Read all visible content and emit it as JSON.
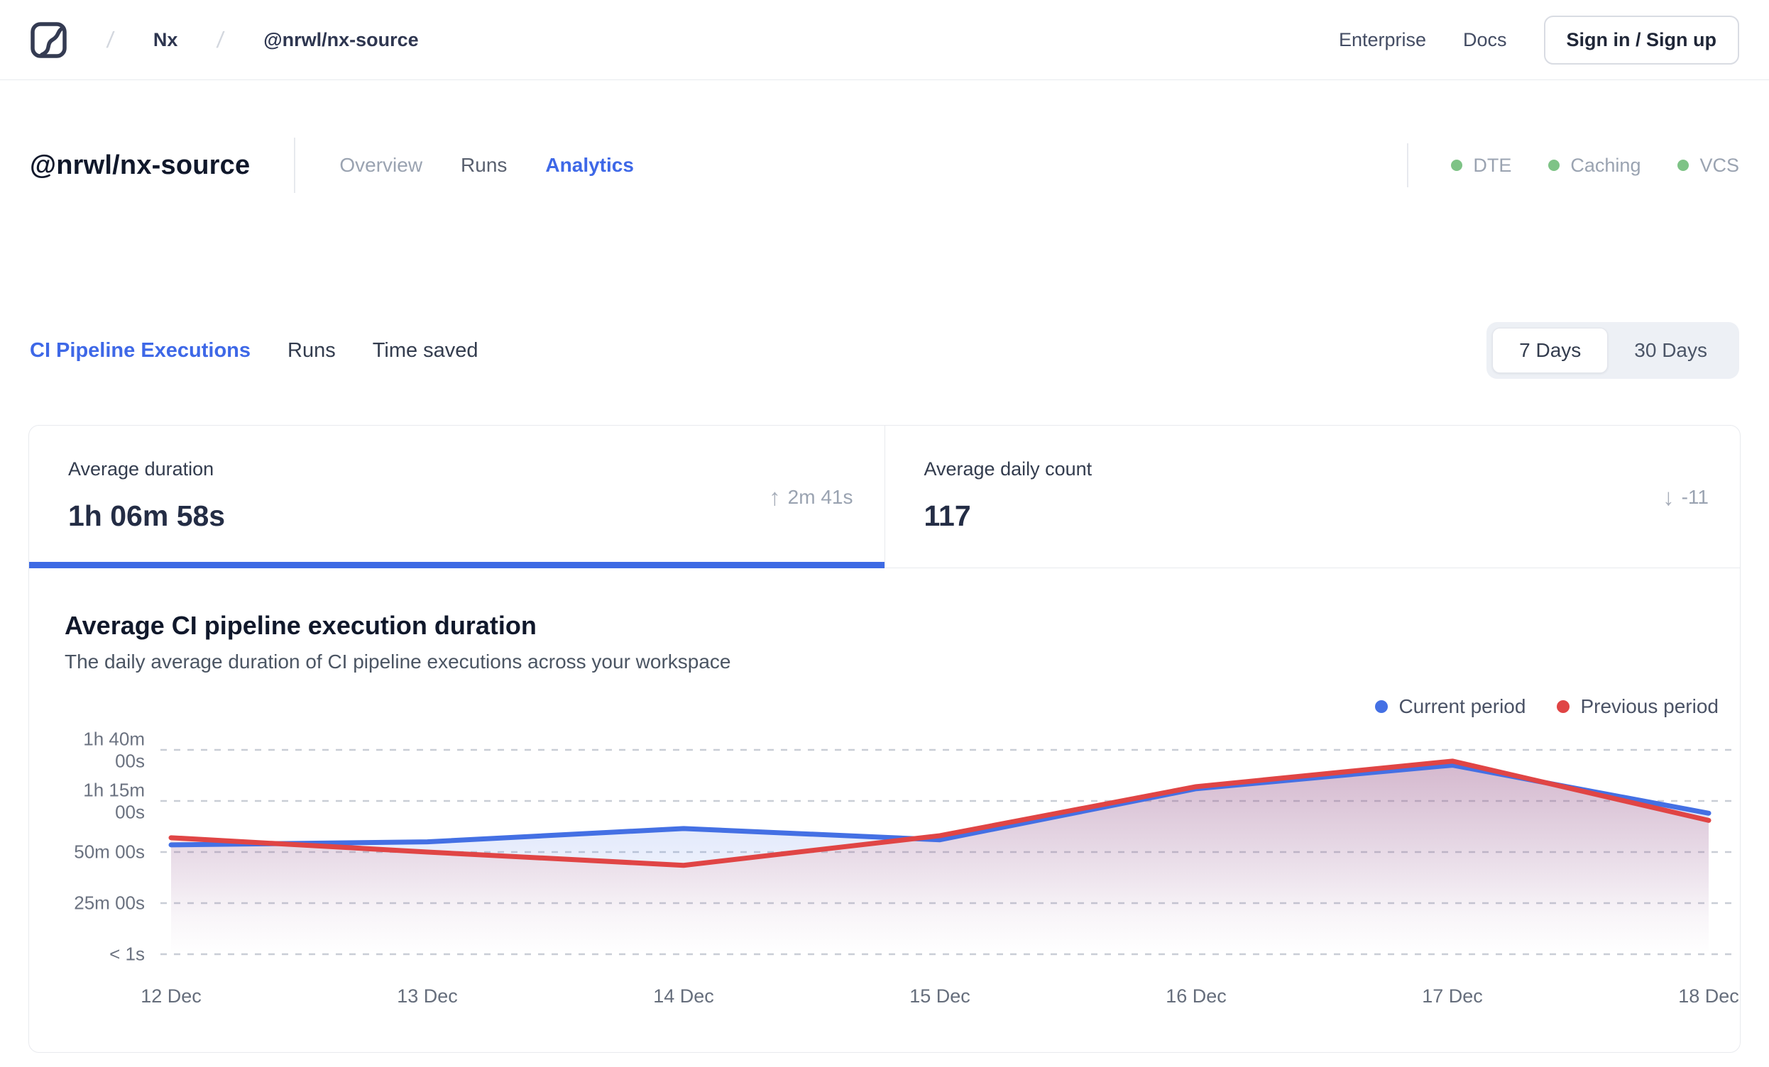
{
  "header": {
    "breadcrumb": {
      "separator": "/",
      "workspace": "Nx",
      "project": "@nrwl/nx-source"
    },
    "nav": {
      "enterprise": "Enterprise",
      "docs": "Docs",
      "sign_in": "Sign in / Sign up"
    }
  },
  "title_bar": {
    "title": "@nrwl/nx-source",
    "tabs": [
      {
        "label": "Overview",
        "active": false
      },
      {
        "label": "Runs",
        "active": false
      },
      {
        "label": "Analytics",
        "active": true
      }
    ],
    "statuses": [
      {
        "label": "DTE",
        "color": "#7ec386"
      },
      {
        "label": "Caching",
        "color": "#7ec386"
      },
      {
        "label": "VCS",
        "color": "#7ec386"
      }
    ]
  },
  "section_tabs": {
    "items": [
      {
        "label": "CI Pipeline Executions",
        "active": true
      },
      {
        "label": "Runs",
        "active": false
      },
      {
        "label": "Time saved",
        "active": false
      }
    ],
    "range_toggle": [
      {
        "label": "7 Days",
        "selected": true
      },
      {
        "label": "30 Days",
        "selected": false
      }
    ]
  },
  "stats": {
    "cards": [
      {
        "label": "Average duration",
        "value": "1h 06m 58s",
        "arrow_glyph": "↑",
        "delta": "2m 41s",
        "delta_direction": "up",
        "active": true
      },
      {
        "label": "Average daily count",
        "value": "117",
        "arrow_glyph": "↓",
        "delta": "-11",
        "delta_direction": "down",
        "active": false
      }
    ]
  },
  "chart_data": {
    "type": "line",
    "title": "Average CI pipeline execution duration",
    "subtitle": "The daily average duration of CI pipeline executions across your workspace",
    "x_labels": [
      "12 Dec",
      "13 Dec",
      "14 Dec",
      "15 Dec",
      "16 Dec",
      "17 Dec",
      "18 Dec"
    ],
    "unit": "minutes",
    "ylim_minutes": [
      0,
      107
    ],
    "grid": "dashed-horizontal",
    "legend_position": "top-right",
    "y_ticks": [
      {
        "label_lines": [
          "1h 40m",
          "00s"
        ],
        "minutes": 100
      },
      {
        "label_lines": [
          "1h 15m",
          "00s"
        ],
        "minutes": 75
      },
      {
        "label_lines": [
          "50m 00s"
        ],
        "minutes": 50
      },
      {
        "label_lines": [
          "25m 00s"
        ],
        "minutes": 25
      },
      {
        "label_lines": [
          "< 1s"
        ],
        "minutes": 0
      }
    ],
    "series": [
      {
        "name": "Current period",
        "color": "#4470e4",
        "values_minutes": [
          53.5,
          55,
          61.5,
          56,
          81,
          92.5,
          69
        ]
      },
      {
        "name": "Previous period",
        "color": "#e04545",
        "values_minutes": [
          57,
          50,
          43.5,
          58,
          82,
          94.5,
          65.5
        ]
      }
    ]
  }
}
